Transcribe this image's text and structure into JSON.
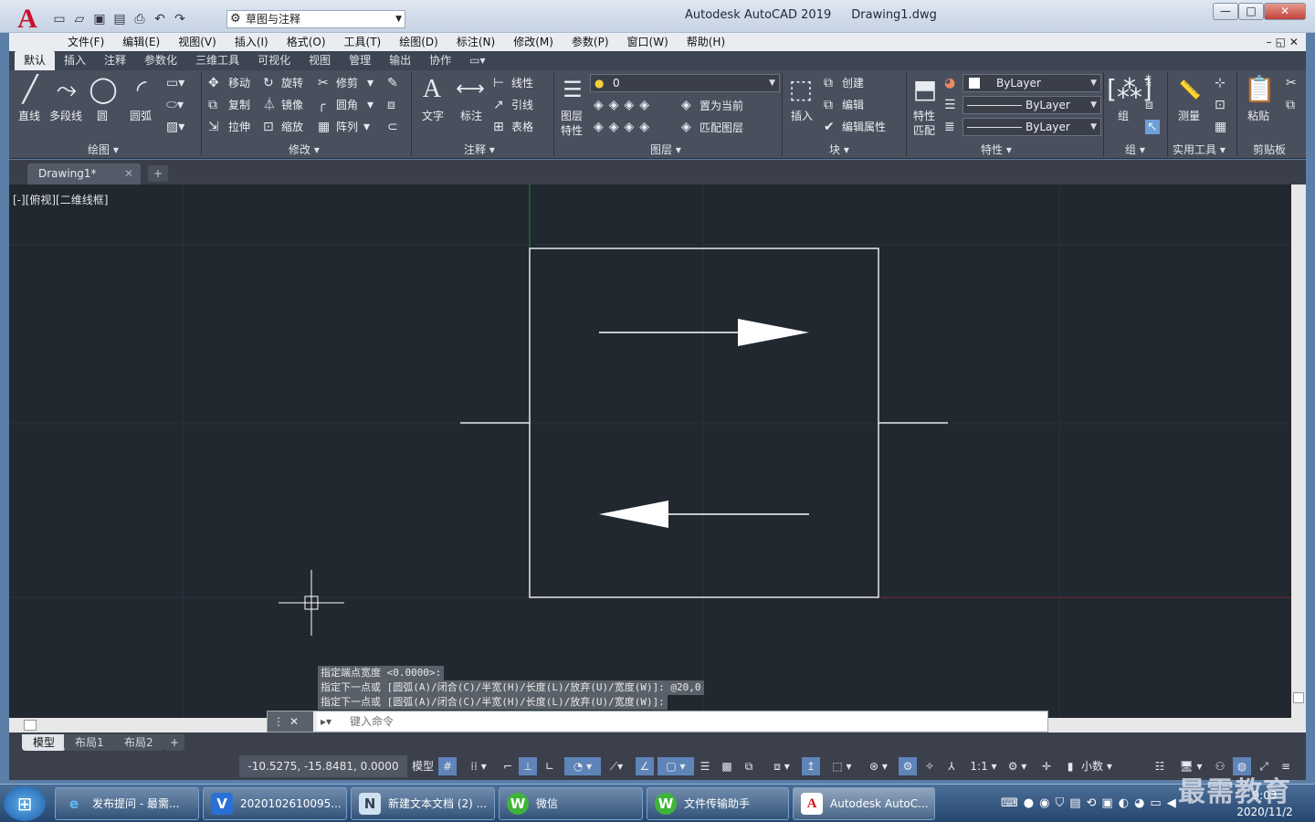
{
  "window": {
    "app_title": "Autodesk AutoCAD 2019",
    "doc_title": "Drawing1.dwg",
    "app_logo": "A",
    "workspace": "草图与注释"
  },
  "qat": [
    "new-icon",
    "open-icon",
    "save-icon",
    "saveas-icon",
    "print-icon",
    "undo-icon",
    "redo-icon"
  ],
  "menu": [
    "文件(F)",
    "编辑(E)",
    "视图(V)",
    "插入(I)",
    "格式(O)",
    "工具(T)",
    "绘图(D)",
    "标注(N)",
    "修改(M)",
    "参数(P)",
    "窗口(W)",
    "帮助(H)"
  ],
  "ribbon_tabs": [
    "默认",
    "插入",
    "注释",
    "参数化",
    "三维工具",
    "可视化",
    "视图",
    "管理",
    "输出",
    "协作"
  ],
  "ribbon": {
    "draw": {
      "title": "绘图",
      "line": "直线",
      "polyline": "多段线",
      "circle": "圆",
      "arc": "圆弧"
    },
    "modify": {
      "title": "修改",
      "move": "移动",
      "rotate": "旋转",
      "trim": "修剪",
      "copy": "复制",
      "mirror": "镜像",
      "fillet": "圆角",
      "stretch": "拉伸",
      "scale": "缩放",
      "array": "阵列"
    },
    "annotation": {
      "title": "注释",
      "text": "文字",
      "dim": "标注",
      "linear": "线性",
      "leader": "引线",
      "table": "表格"
    },
    "layers": {
      "title": "图层",
      "props": "图层特性",
      "current_layer": "0",
      "set_current": "置为当前",
      "match": "匹配图层"
    },
    "block": {
      "title": "块",
      "insert": "插入",
      "create": "创建",
      "edit": "编辑",
      "edit_attr": "编辑属性"
    },
    "properties": {
      "title": "特性",
      "match": "特性匹配",
      "color": "ByLayer",
      "linetype": "ByLayer",
      "lineweight": "ByLayer"
    },
    "groups": {
      "title": "组",
      "group": "组"
    },
    "utilities": {
      "title": "实用工具",
      "measure": "测量"
    },
    "clipboard": {
      "title": "剪贴板",
      "paste": "粘贴"
    }
  },
  "doc_tab": "Drawing1*",
  "viewport_label": "[-][俯视][二维线框]",
  "command_history": [
    "指定端点宽度 <0.0000>:",
    "指定下一点或 [圆弧(A)/闭合(C)/半宽(H)/长度(L)/放弃(U)/宽度(W)]: @20,0",
    "指定下一点或 [圆弧(A)/闭合(C)/半宽(H)/长度(L)/放弃(U)/宽度(W)]:"
  ],
  "command_placeholder": "键入命令",
  "layout_tabs": [
    "模型",
    "布局1",
    "布局2"
  ],
  "status": {
    "coords": "-10.5275, -15.8481, 0.0000",
    "model": "模型",
    "scale": "1:1",
    "units": "小数"
  },
  "taskbar": [
    {
      "label": "发布提问 - 最需...",
      "icon": "e"
    },
    {
      "label": "2020102610095...",
      "icon": "V"
    },
    {
      "label": "新建文本文档 (2) ...",
      "icon": "N"
    },
    {
      "label": "微信",
      "icon": "W"
    },
    {
      "label": "文件传输助手",
      "icon": "W"
    },
    {
      "label": "Autodesk AutoC...",
      "icon": "A"
    }
  ],
  "clock": {
    "time": "9:03",
    "date": "2020/11/2"
  },
  "watermark": "最需教育",
  "colors": {
    "canvas": "#212830",
    "ribbon": "#494f5c",
    "accent": "#c8102e"
  }
}
